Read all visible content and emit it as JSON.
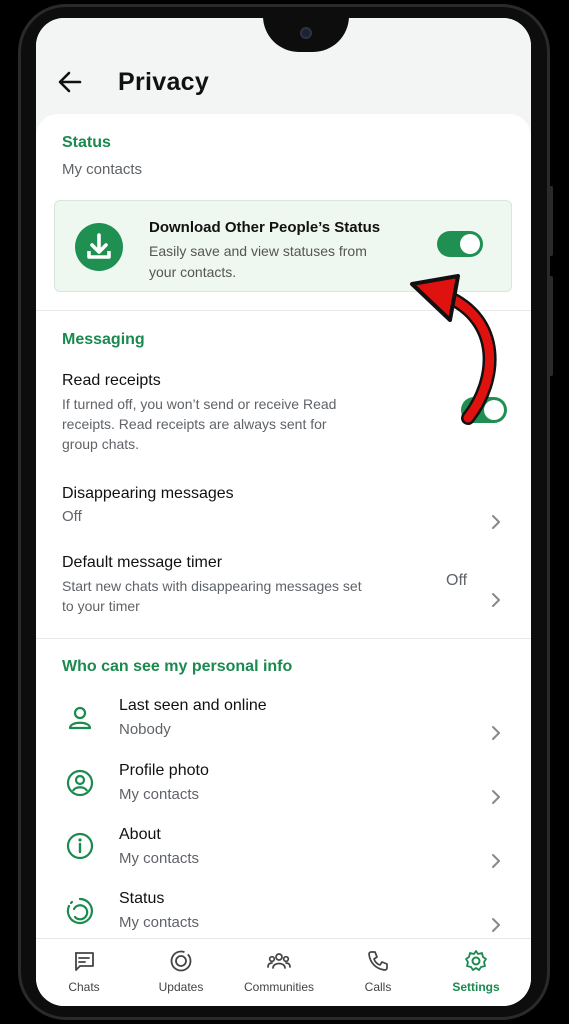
{
  "header": {
    "title": "Privacy"
  },
  "status": {
    "section_title": "Status",
    "value": "My contacts"
  },
  "promo": {
    "icon": "download-icon",
    "title": "Download Other People’s Status",
    "description": "Easily save and view statuses from your contacts.",
    "toggle_on": true
  },
  "messaging": {
    "section_title": "Messaging",
    "read_receipts": {
      "label": "Read receipts",
      "description": "If turned off, you won’t send or receive Read receipts. Read receipts are always sent for group chats.",
      "toggle_on": true
    },
    "disappearing": {
      "label": "Disappearing messages",
      "value": "Off"
    },
    "default_timer": {
      "label": "Default message timer",
      "description": "Start new chats with disappearing messages set to your timer",
      "value": "Off"
    }
  },
  "personal_info": {
    "section_title": "Who can see my personal info",
    "items": [
      {
        "label": "Last seen and online",
        "value": "Nobody",
        "icon": "person-icon"
      },
      {
        "label": "Profile photo",
        "value": "My contacts",
        "icon": "profile-photo-icon"
      },
      {
        "label": "About",
        "value": "My contacts",
        "icon": "info-icon"
      },
      {
        "label": "Status",
        "value": "My contacts",
        "icon": "status-icon"
      }
    ]
  },
  "nav": {
    "items": [
      {
        "label": "Chats",
        "icon": "chat-icon"
      },
      {
        "label": "Updates",
        "icon": "updates-icon"
      },
      {
        "label": "Communities",
        "icon": "communities-icon"
      },
      {
        "label": "Calls",
        "icon": "phone-icon"
      },
      {
        "label": "Settings",
        "icon": "gear-icon",
        "active": true
      }
    ]
  },
  "colors": {
    "accent": "#1b8a4f",
    "toggle": "#1f8f52",
    "arrow": "#e0120f"
  }
}
